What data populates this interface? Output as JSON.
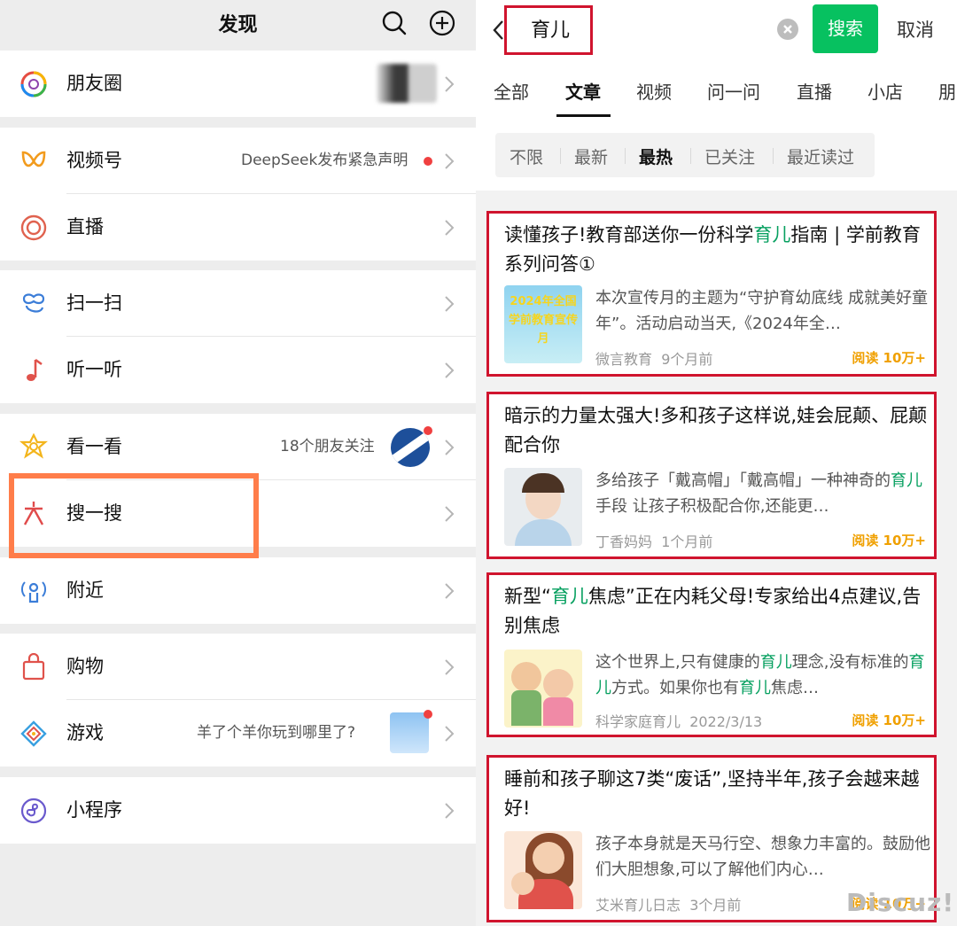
{
  "left": {
    "header_title": "发现",
    "items": [
      {
        "label": "朋友圈",
        "extra": ""
      },
      {
        "label": "视频号",
        "extra": "DeepSeek发布紧急声明"
      },
      {
        "label": "直播",
        "extra": ""
      },
      {
        "label": "扫一扫",
        "extra": ""
      },
      {
        "label": "听一听",
        "extra": ""
      },
      {
        "label": "看一看",
        "extra": "18个朋友关注"
      },
      {
        "label": "搜一搜",
        "extra": ""
      },
      {
        "label": "附近",
        "extra": ""
      },
      {
        "label": "购物",
        "extra": ""
      },
      {
        "label": "游戏",
        "extra": "羊了个羊你玩到哪里了?"
      },
      {
        "label": "小程序",
        "extra": ""
      }
    ]
  },
  "right": {
    "search": {
      "query": "育儿",
      "button": "搜索",
      "cancel": "取消"
    },
    "tabs": [
      "全部",
      "文章",
      "视频",
      "问一问",
      "直播",
      "小店",
      "朋"
    ],
    "active_tab": "文章",
    "filters": [
      "不限",
      "最新",
      "最热",
      "已关注",
      "最近读过"
    ],
    "active_filter": "最热",
    "results": [
      {
        "title_parts": [
          "读懂孩子!教育部送你一份科学",
          "育儿",
          "指南 | 学前教育系列问答①"
        ],
        "desc_parts": [
          "本次宣传月的主题为“守护育幼底线 成就美好童年”。活动启动当天,《2024年全…"
        ],
        "thumb_text": "2024年全国学前教育宣传月",
        "source": "微言教育",
        "time": "9个月前",
        "reads": "阅读 10万+"
      },
      {
        "title_parts": [
          "暗示的力量太强大!多和孩子这样说,娃会屁颠、屁颠配合你"
        ],
        "desc_parts": [
          "多给孩子「戴高帽」「戴高帽」一种神奇的",
          "育儿",
          "手段 让孩子积极配合你,还能更…"
        ],
        "thumb_text": "",
        "source": "丁香妈妈",
        "time": "1个月前",
        "reads": "阅读 10万+"
      },
      {
        "title_parts": [
          "新型“",
          "育儿",
          "焦虑”正在内耗父母!专家给出4点建议,告别焦虑"
        ],
        "desc_parts": [
          "这个世界上,只有健康的",
          "育儿",
          "理念,没有标准的",
          "育儿",
          "方式。如果你也有",
          "育儿",
          "焦虑…"
        ],
        "thumb_text": "",
        "source": "科学家庭育儿",
        "time": "2022/3/13",
        "reads": "阅读 10万+"
      },
      {
        "title_parts": [
          "睡前和孩子聊这7类“废话”,坚持半年,孩子会越来越好!"
        ],
        "desc_parts": [
          "孩子本身就是天马行空、想象力丰富的。鼓励他们大胆想象,可以了解他们内心…"
        ],
        "thumb_text": "",
        "source": "艾米育儿日志",
        "time": "3个月前",
        "reads": "阅读 10万+"
      }
    ]
  },
  "watermark": "Discuz!",
  "colors": {
    "accent_green": "#07c160",
    "highlight_orange": "#ff7d4a",
    "red_box": "#d0142e",
    "read_gold": "#f0a000"
  }
}
